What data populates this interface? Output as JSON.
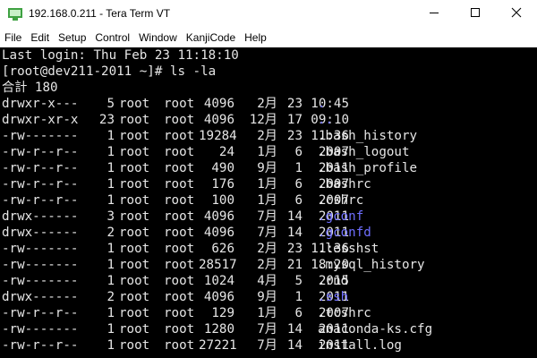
{
  "window": {
    "title": "192.168.0.211 - Tera Term VT"
  },
  "menu": [
    "File",
    "Edit",
    "Setup",
    "Control",
    "Window",
    "KanjiCode",
    "Help"
  ],
  "terminal": {
    "lines": [
      "Last login: Thu Feb 23 11:18:10",
      "[root@dev211-2011 ~]# ls -la",
      "合計 180"
    ],
    "entries": [
      {
        "perm": "drwxr-x---",
        "links": "5",
        "owner": "root",
        "group": "root",
        "size": "4096",
        "month": "2月",
        "day": "23",
        "time": "10:45",
        "name": ".",
        "type": "dir"
      },
      {
        "perm": "drwxr-xr-x",
        "links": "23",
        "owner": "root",
        "group": "root",
        "size": "4096",
        "month": "12月",
        "day": "17",
        "time": "09:10",
        "name": "..",
        "type": "dir"
      },
      {
        "perm": "-rw-------",
        "links": "1",
        "owner": "root",
        "group": "root",
        "size": "19284",
        "month": "2月",
        "day": "23",
        "time": "11:36",
        "name": ".bash_history",
        "type": "file"
      },
      {
        "perm": "-rw-r--r--",
        "links": "1",
        "owner": "root",
        "group": "root",
        "size": "24",
        "month": "1月",
        "day": "6",
        "time": "2007",
        "name": ".bash_logout",
        "type": "file"
      },
      {
        "perm": "-rw-r--r--",
        "links": "1",
        "owner": "root",
        "group": "root",
        "size": "490",
        "month": "9月",
        "day": "1",
        "time": "2011",
        "name": ".bash_profile",
        "type": "file"
      },
      {
        "perm": "-rw-r--r--",
        "links": "1",
        "owner": "root",
        "group": "root",
        "size": "176",
        "month": "1月",
        "day": "6",
        "time": "2007",
        "name": ".bashrc",
        "type": "file"
      },
      {
        "perm": "-rw-r--r--",
        "links": "1",
        "owner": "root",
        "group": "root",
        "size": "100",
        "month": "1月",
        "day": "6",
        "time": "2007",
        "name": ".cshrc",
        "type": "file"
      },
      {
        "perm": "drwx------",
        "links": "3",
        "owner": "root",
        "group": "root",
        "size": "4096",
        "month": "7月",
        "day": "14",
        "time": "2011",
        "name": ".gconf",
        "type": "dir"
      },
      {
        "perm": "drwx------",
        "links": "2",
        "owner": "root",
        "group": "root",
        "size": "4096",
        "month": "7月",
        "day": "14",
        "time": "2011",
        "name": ".gconfd",
        "type": "dir"
      },
      {
        "perm": "-rw-------",
        "links": "1",
        "owner": "root",
        "group": "root",
        "size": "626",
        "month": "2月",
        "day": "23",
        "time": "11:36",
        "name": ".lesshst",
        "type": "file"
      },
      {
        "perm": "-rw-------",
        "links": "1",
        "owner": "root",
        "group": "root",
        "size": "28517",
        "month": "2月",
        "day": "21",
        "time": "18:20",
        "name": ".mysql_history",
        "type": "file"
      },
      {
        "perm": "-rw-------",
        "links": "1",
        "owner": "root",
        "group": "root",
        "size": "1024",
        "month": "4月",
        "day": "5",
        "time": "2015",
        "name": ".rnd",
        "type": "file"
      },
      {
        "perm": "drwx------",
        "links": "2",
        "owner": "root",
        "group": "root",
        "size": "4096",
        "month": "9月",
        "day": "1",
        "time": "2011",
        "name": ".ssh",
        "type": "dir"
      },
      {
        "perm": "-rw-r--r--",
        "links": "1",
        "owner": "root",
        "group": "root",
        "size": "129",
        "month": "1月",
        "day": "6",
        "time": "2007",
        "name": ".tcshrc",
        "type": "file"
      },
      {
        "perm": "-rw-------",
        "links": "1",
        "owner": "root",
        "group": "root",
        "size": "1280",
        "month": "7月",
        "day": "14",
        "time": "2011",
        "name": "anaconda-ks.cfg",
        "type": "file"
      },
      {
        "perm": "-rw-r--r--",
        "links": "1",
        "owner": "root",
        "group": "root",
        "size": "27221",
        "month": "7月",
        "day": "14",
        "time": "2011",
        "name": "install.log",
        "type": "file"
      }
    ]
  },
  "colors": {
    "terminal_bg": "#000000",
    "terminal_fg": "#e6e6e6",
    "directory": "#6f6fff"
  },
  "icons": {
    "app": "tera-term-icon",
    "minimize": "minimize-icon",
    "maximize": "maximize-icon",
    "close": "close-icon"
  }
}
